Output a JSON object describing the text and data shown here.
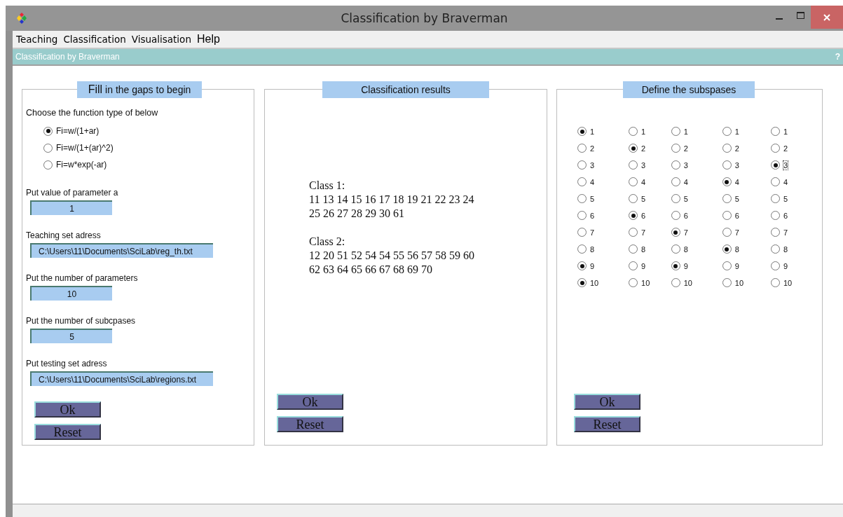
{
  "window": {
    "title": "Classification by Braverman"
  },
  "menu": [
    "Teaching",
    "Classification",
    "Visualisation",
    "Help"
  ],
  "header": {
    "title": "Classification by Braverman",
    "help": "?"
  },
  "setup": {
    "title_bold": "Fill",
    "title": "in the gaps to begin",
    "prompt": "Choose the function type of below",
    "functions": [
      {
        "label": "Fi=w/(1+ar)",
        "selected": true
      },
      {
        "label": "Fi=w/(1+(ar)^2)",
        "selected": false
      },
      {
        "label": "Fi=w*exp(-ar)",
        "selected": false
      }
    ],
    "fields": [
      {
        "label": "Put value of parameter a",
        "value": "1",
        "kind": "short"
      },
      {
        "label": "Teaching set adress",
        "value": "C:\\Users\\11\\Documents\\SciLab\\reg_th.txt",
        "kind": "long"
      },
      {
        "label": "Put the number of parameters",
        "value": "10",
        "kind": "short"
      },
      {
        "label": "Put the number of subcpases",
        "value": "5",
        "kind": "short"
      },
      {
        "label": "Put testing set adress",
        "value": "C:\\Users\\11\\Documents\\SciLab\\regions.txt",
        "kind": "long"
      }
    ],
    "buttons": [
      "Ok",
      "Reset"
    ]
  },
  "results": {
    "title": "Classification results",
    "classes": [
      {
        "name": "Class 1:",
        "lines": [
          "11 13 14 15 16 17 18 19 21 22 23 24",
          "25 26 27 28 29 30 61"
        ]
      },
      {
        "name": "Class 2:",
        "lines": [
          "12 20 51 52 54 54 55 56 57 58 59 60",
          "62 63 64 65 66 67 68 69 70"
        ]
      }
    ],
    "buttons": [
      "Ok",
      "Reset"
    ]
  },
  "subspaces": {
    "title": "Define the subspases",
    "columns": [
      {
        "options": [
          {
            "label": "1",
            "selected": true,
            "focused": false
          },
          {
            "label": "2",
            "selected": false,
            "focused": false
          },
          {
            "label": "3",
            "selected": false,
            "focused": false
          },
          {
            "label": "4",
            "selected": false,
            "focused": false
          },
          {
            "label": "5",
            "selected": false,
            "focused": false
          },
          {
            "label": "6",
            "selected": false,
            "focused": false
          },
          {
            "label": "7",
            "selected": false,
            "focused": false
          },
          {
            "label": "8",
            "selected": false,
            "focused": false
          },
          {
            "label": "9",
            "selected": true,
            "focused": false
          },
          {
            "label": "10",
            "selected": true,
            "focused": false
          }
        ]
      },
      {
        "options": [
          {
            "label": "1",
            "selected": false,
            "focused": false
          },
          {
            "label": "2",
            "selected": true,
            "focused": false
          },
          {
            "label": "3",
            "selected": false,
            "focused": false
          },
          {
            "label": "4",
            "selected": false,
            "focused": false
          },
          {
            "label": "5",
            "selected": false,
            "focused": false
          },
          {
            "label": "6",
            "selected": true,
            "focused": false
          },
          {
            "label": "7",
            "selected": false,
            "focused": false
          },
          {
            "label": "8",
            "selected": false,
            "focused": false
          },
          {
            "label": "9",
            "selected": false,
            "focused": false
          },
          {
            "label": "10",
            "selected": false,
            "focused": false
          }
        ]
      },
      {
        "options": [
          {
            "label": "1",
            "selected": false,
            "focused": false
          },
          {
            "label": "2",
            "selected": false,
            "focused": false
          },
          {
            "label": "3",
            "selected": false,
            "focused": false
          },
          {
            "label": "4",
            "selected": false,
            "focused": false
          },
          {
            "label": "5",
            "selected": false,
            "focused": false
          },
          {
            "label": "6",
            "selected": false,
            "focused": false
          },
          {
            "label": "7",
            "selected": true,
            "focused": false
          },
          {
            "label": "8",
            "selected": false,
            "focused": false
          },
          {
            "label": "9",
            "selected": true,
            "focused": false
          },
          {
            "label": "10",
            "selected": false,
            "focused": false
          }
        ]
      },
      {
        "options": [
          {
            "label": "1",
            "selected": false,
            "focused": false
          },
          {
            "label": "2",
            "selected": false,
            "focused": false
          },
          {
            "label": "3",
            "selected": false,
            "focused": false
          },
          {
            "label": "4",
            "selected": true,
            "focused": false
          },
          {
            "label": "5",
            "selected": false,
            "focused": false
          },
          {
            "label": "6",
            "selected": false,
            "focused": false
          },
          {
            "label": "7",
            "selected": false,
            "focused": false
          },
          {
            "label": "8",
            "selected": true,
            "focused": false
          },
          {
            "label": "9",
            "selected": false,
            "focused": false
          },
          {
            "label": "10",
            "selected": false,
            "focused": false
          }
        ]
      },
      {
        "options": [
          {
            "label": "1",
            "selected": false,
            "focused": false
          },
          {
            "label": "2",
            "selected": false,
            "focused": false
          },
          {
            "label": "3",
            "selected": true,
            "focused": true
          },
          {
            "label": "4",
            "selected": false,
            "focused": false
          },
          {
            "label": "5",
            "selected": false,
            "focused": false
          },
          {
            "label": "6",
            "selected": false,
            "focused": false
          },
          {
            "label": "7",
            "selected": false,
            "focused": false
          },
          {
            "label": "8",
            "selected": false,
            "focused": false
          },
          {
            "label": "9",
            "selected": false,
            "focused": false
          },
          {
            "label": "10",
            "selected": false,
            "focused": false
          }
        ]
      }
    ],
    "buttons": [
      "Ok",
      "Reset"
    ]
  }
}
